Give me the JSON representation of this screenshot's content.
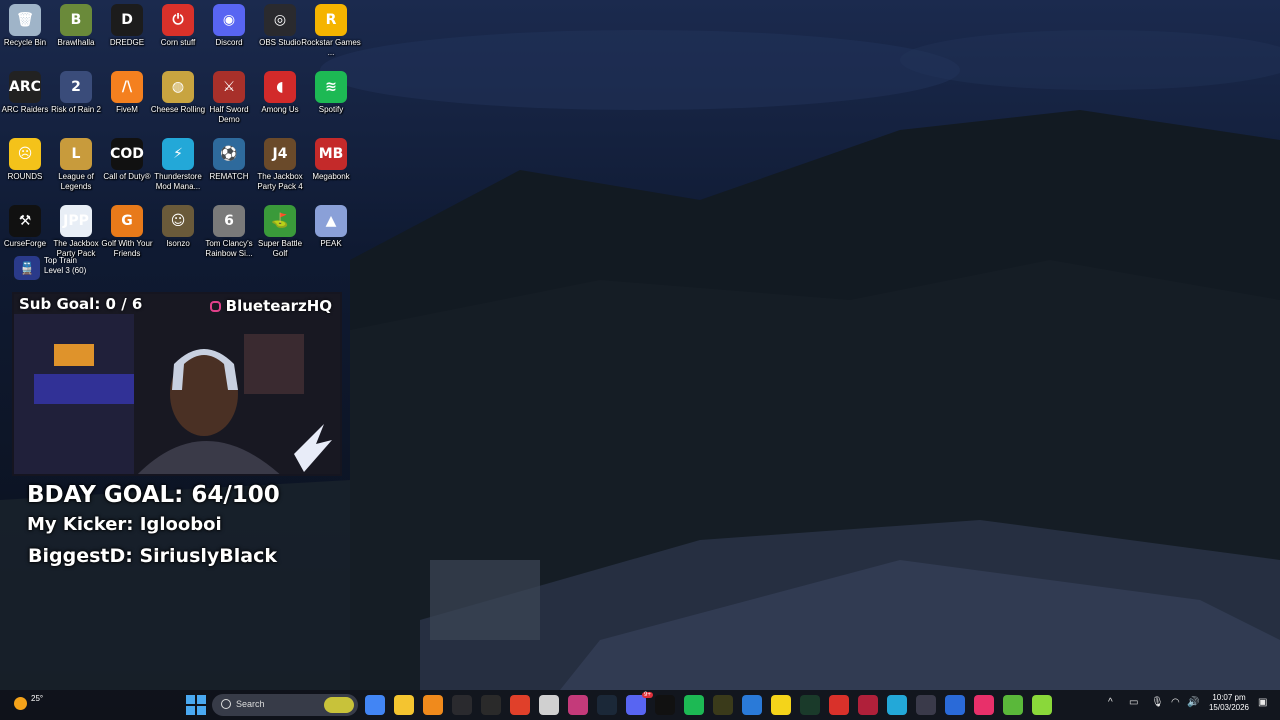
{
  "desktop_icons": [
    {
      "label": "Recycle Bin",
      "icon": "recycle-bin-icon",
      "color": "#9fb4c8",
      "glyph": "🗑"
    },
    {
      "label": "Brawlhalla",
      "icon": "brawlhalla-icon",
      "color": "#6a8a3a",
      "glyph": "B"
    },
    {
      "label": "DREDGE",
      "icon": "dredge-icon",
      "color": "#1c1c1c",
      "glyph": "D"
    },
    {
      "label": "Corn stuff",
      "icon": "corn-stuff-icon",
      "color": "#d9312a",
      "glyph": "⏻"
    },
    {
      "label": "Discord",
      "icon": "discord-icon",
      "color": "#5865f2",
      "glyph": "◉"
    },
    {
      "label": "OBS Studio",
      "icon": "obs-studio-icon",
      "color": "#2a2a2e",
      "glyph": "◎"
    },
    {
      "label": "Rockstar Games ...",
      "icon": "rockstar-games-icon",
      "color": "#f5b400",
      "glyph": "R"
    },
    {
      "label": "ARC Raiders",
      "icon": "arc-raiders-icon",
      "color": "#222",
      "glyph": "ARC"
    },
    {
      "label": "Risk of Rain 2",
      "icon": "risk-of-rain-2-icon",
      "color": "#3a4c7a",
      "glyph": "2"
    },
    {
      "label": "FiveM",
      "icon": "fivem-icon",
      "color": "#f4801f",
      "glyph": "/\\"
    },
    {
      "label": "Cheese Rolling",
      "icon": "cheese-rolling-icon",
      "color": "#c8a440",
      "glyph": "◍"
    },
    {
      "label": "Half Sword Demo",
      "icon": "half-sword-icon",
      "color": "#a8302a",
      "glyph": "⚔"
    },
    {
      "label": "Among Us",
      "icon": "among-us-icon",
      "color": "#d22a2a",
      "glyph": "◖"
    },
    {
      "label": "Spotify",
      "icon": "spotify-icon",
      "color": "#1db954",
      "glyph": "≋"
    },
    {
      "label": "ROUNDS",
      "icon": "rounds-icon",
      "color": "#f4c21a",
      "glyph": "☹"
    },
    {
      "label": "League of Legends",
      "icon": "league-of-legends-icon",
      "color": "#c89b3c",
      "glyph": "L"
    },
    {
      "label": "Call of Duty®",
      "icon": "call-of-duty-icon",
      "color": "#111",
      "glyph": "COD"
    },
    {
      "label": "Thunderstore Mod Mana...",
      "icon": "thunderstore-icon",
      "color": "#23a8d8",
      "glyph": "⚡"
    },
    {
      "label": "REMATCH",
      "icon": "rematch-icon",
      "color": "#2e6a9c",
      "glyph": "⚽"
    },
    {
      "label": "The Jackbox Party Pack 4",
      "icon": "jackbox-4-icon",
      "color": "#6a4a2a",
      "glyph": "J4"
    },
    {
      "label": "Megabonk",
      "icon": "megabonk-icon",
      "color": "#c42a2a",
      "glyph": "MB"
    },
    {
      "label": "CurseForge",
      "icon": "curseforge-icon",
      "color": "#111",
      "glyph": "⚒"
    },
    {
      "label": "The Jackbox Party Pack",
      "icon": "jackbox-icon",
      "color": "#e8eef6",
      "glyph": "JPP"
    },
    {
      "label": "Golf With Your Friends",
      "icon": "golf-with-friends-icon",
      "color": "#e87a1a",
      "glyph": "G"
    },
    {
      "label": "Isonzo",
      "icon": "isonzo-icon",
      "color": "#6a5a3a",
      "glyph": "☺"
    },
    {
      "label": "Tom Clancy's Rainbow Si...",
      "icon": "rainbow-six-icon",
      "color": "#7a7a7a",
      "glyph": "6"
    },
    {
      "label": "Super Battle Golf",
      "icon": "super-battle-golf-icon",
      "color": "#3a9a3a",
      "glyph": "⛳"
    },
    {
      "label": "PEAK",
      "icon": "peak-icon",
      "color": "#8aa0d8",
      "glyph": "▲"
    }
  ],
  "train_notice": {
    "title": "Top Train",
    "detail": "Level 3 (60)"
  },
  "stream_overlay": {
    "sub_goal": "Sub Goal:  0 / 6",
    "handle": "BluetearzHQ",
    "bday_goal": "BDAY GOAL: 64/100",
    "kicker": "My Kicker: Iglooboi",
    "biggest": "BiggestD: SiriuslyBlack"
  },
  "taskbar": {
    "weather": "25°",
    "search_placeholder": "Search",
    "apps": [
      {
        "icon": "chrome-icon",
        "color": "#4285f4"
      },
      {
        "icon": "file-explorer-icon",
        "color": "#f4c430"
      },
      {
        "icon": "vlc-icon",
        "color": "#f08a1c"
      },
      {
        "icon": "obs-icon",
        "color": "#2a2a2e"
      },
      {
        "icon": "epic-games-icon",
        "color": "#2a2a2a"
      },
      {
        "icon": "app-red-icon",
        "color": "#e0402a"
      },
      {
        "icon": "notes-icon",
        "color": "#d0d0d0"
      },
      {
        "icon": "app-pink-icon",
        "color": "#c43a7a"
      },
      {
        "icon": "steam-icon",
        "color": "#1b2838"
      },
      {
        "icon": "discord-icon",
        "color": "#5865f2"
      },
      {
        "icon": "capcut-icon",
        "color": "#111111"
      },
      {
        "icon": "spotify-icon",
        "color": "#1db954"
      },
      {
        "icon": "xbox-icon",
        "color": "#3a3a1a"
      },
      {
        "icon": "photos-icon",
        "color": "#2a7ad8"
      },
      {
        "icon": "sticky-notes-icon",
        "color": "#f4d41a"
      },
      {
        "icon": "terminal-icon",
        "color": "#1a3a2a"
      },
      {
        "icon": "corn-stuff-icon",
        "color": "#d9312a"
      },
      {
        "icon": "app-f-icon",
        "color": "#b0203a"
      },
      {
        "icon": "thunderstore-icon",
        "color": "#23a8d8"
      },
      {
        "icon": "app-circle-icon",
        "color": "#3a3a4a"
      },
      {
        "icon": "microsoft-store-icon",
        "color": "#2a6ad8"
      },
      {
        "icon": "tiktok-icon",
        "color": "#e8306a"
      },
      {
        "icon": "app-green-icon",
        "color": "#5ab83a"
      },
      {
        "icon": "app-lime-icon",
        "color": "#8ad83a"
      }
    ],
    "badge": "9+",
    "time": "10:07 pm",
    "date": "15/03/2026"
  }
}
